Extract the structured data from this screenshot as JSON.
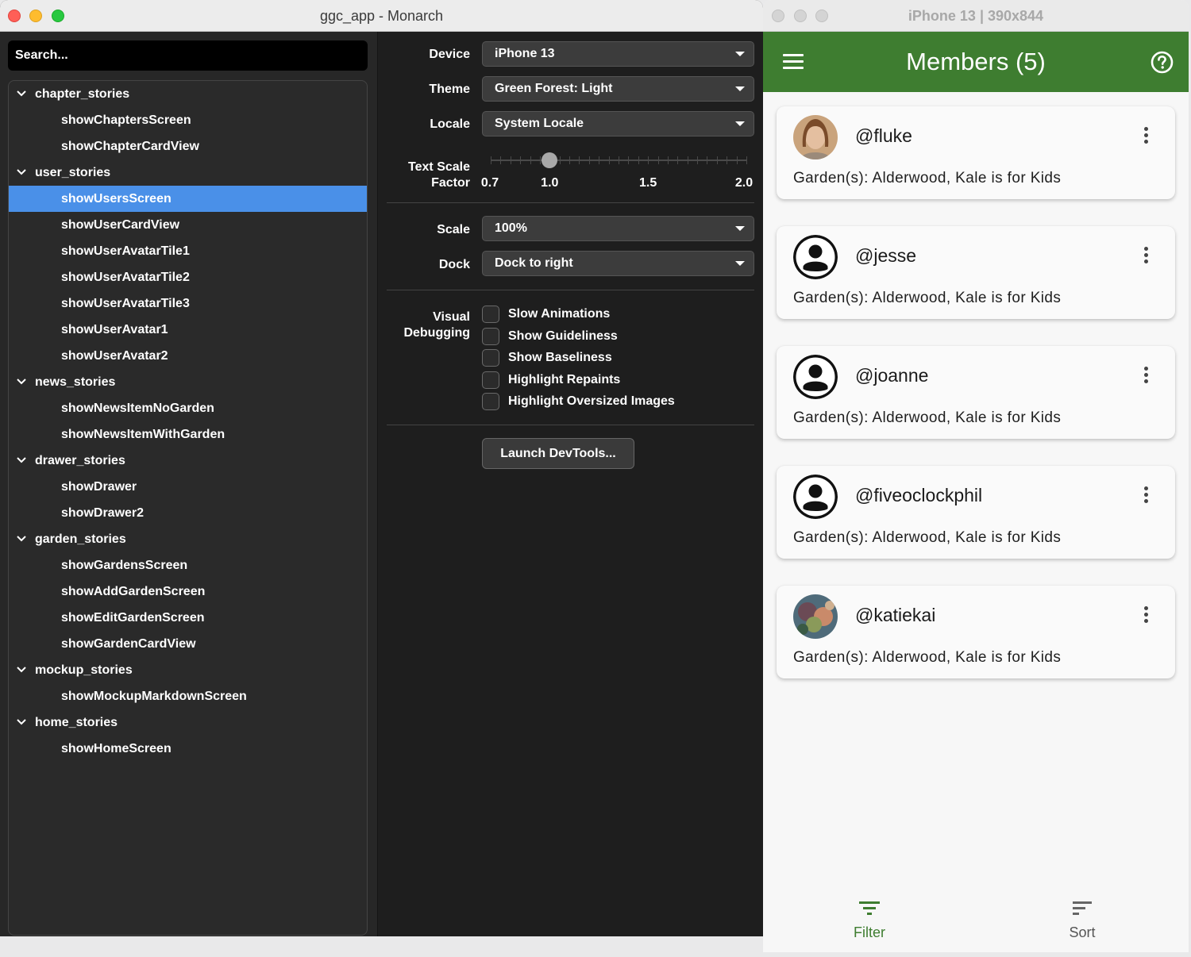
{
  "monarch": {
    "title": "ggc_app - Monarch",
    "search_placeholder": "Search...",
    "tree": [
      {
        "group": "chapter_stories",
        "items": [
          "showChaptersScreen",
          "showChapterCardView"
        ]
      },
      {
        "group": "user_stories",
        "items": [
          "showUsersScreen",
          "showUserCardView",
          "showUserAvatarTile1",
          "showUserAvatarTile2",
          "showUserAvatarTile3",
          "showUserAvatar1",
          "showUserAvatar2"
        ]
      },
      {
        "group": "news_stories",
        "items": [
          "showNewsItemNoGarden",
          "showNewsItemWithGarden"
        ]
      },
      {
        "group": "drawer_stories",
        "items": [
          "showDrawer",
          "showDrawer2"
        ]
      },
      {
        "group": "garden_stories",
        "items": [
          "showGardensScreen",
          "showAddGardenScreen",
          "showEditGardenScreen",
          "showGardenCardView"
        ]
      },
      {
        "group": "mockup_stories",
        "items": [
          "showMockupMarkdownScreen"
        ]
      },
      {
        "group": "home_stories",
        "items": [
          "showHomeScreen"
        ]
      }
    ],
    "selected_story": "showUsersScreen",
    "controls": {
      "device_label": "Device",
      "device_value": "iPhone 13",
      "theme_label": "Theme",
      "theme_value": "Green Forest: Light",
      "locale_label": "Locale",
      "locale_value": "System Locale",
      "text_scale_label_1": "Text Scale",
      "text_scale_label_2": "Factor",
      "text_scale_min": 0.7,
      "text_scale_max": 2.0,
      "text_scale_value": 1.0,
      "text_scale_ticks": [
        "0.7",
        "1.0",
        "1.5",
        "2.0"
      ],
      "scale_label": "Scale",
      "scale_value": "100%",
      "dock_label": "Dock",
      "dock_value": "Dock to right",
      "visual_debugging_label_1": "Visual",
      "visual_debugging_label_2": "Debugging",
      "checkboxes": [
        {
          "label": "Slow Animations",
          "checked": false
        },
        {
          "label": "Show Guideliness",
          "checked": false
        },
        {
          "label": "Show Baseliness",
          "checked": false
        },
        {
          "label": "Highlight Repaints",
          "checked": false
        },
        {
          "label": "Highlight Oversized Images",
          "checked": false
        }
      ],
      "devtools_button": "Launch DevTools..."
    }
  },
  "phone": {
    "window_title": "iPhone 13 | 390x844",
    "appbar_title": "Members (5)",
    "accent_color": "#3e7d30",
    "members": [
      {
        "handle": "@fluke",
        "gardens": "Garden(s): Alderwood, Kale is for Kids",
        "avatar": "photo"
      },
      {
        "handle": "@jesse",
        "gardens": "Garden(s): Alderwood, Kale is for Kids",
        "avatar": "person-icon"
      },
      {
        "handle": "@joanne",
        "gardens": "Garden(s): Alderwood, Kale is for Kids",
        "avatar": "person-icon"
      },
      {
        "handle": "@fiveoclockphil",
        "gardens": "Garden(s): Alderwood, Kale is for Kids",
        "avatar": "person-icon"
      },
      {
        "handle": "@katiekai",
        "gardens": "Garden(s): Alderwood, Kale is for Kids",
        "avatar": "photo"
      }
    ],
    "nav": {
      "filter_label": "Filter",
      "sort_label": "Sort"
    }
  }
}
